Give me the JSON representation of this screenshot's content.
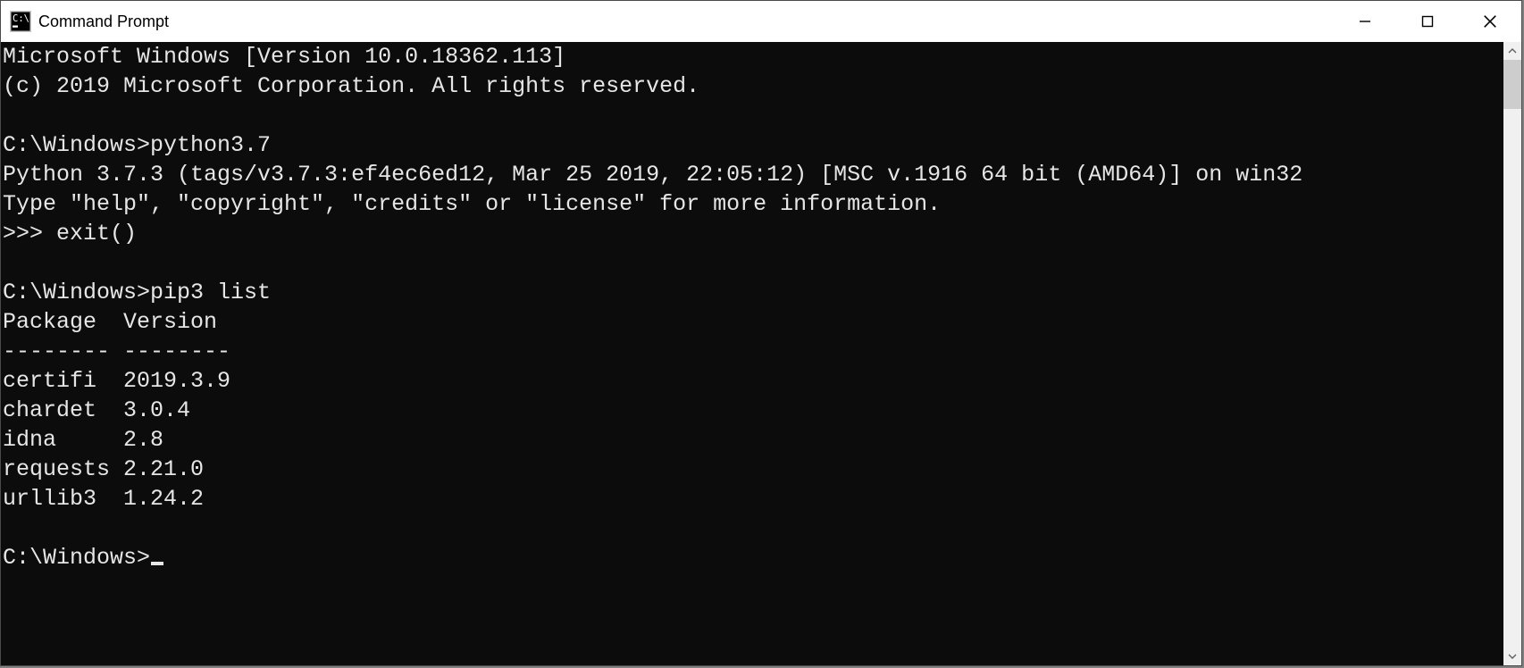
{
  "window": {
    "title": "Command Prompt"
  },
  "terminal": {
    "lines": [
      "Microsoft Windows [Version 10.0.18362.113]",
      "(c) 2019 Microsoft Corporation. All rights reserved.",
      "",
      "C:\\Windows>python3.7",
      "Python 3.7.3 (tags/v3.7.3:ef4ec6ed12, Mar 25 2019, 22:05:12) [MSC v.1916 64 bit (AMD64)] on win32",
      "Type \"help\", \"copyright\", \"credits\" or \"license\" for more information.",
      ">>> exit()",
      "",
      "C:\\Windows>pip3 list",
      "Package  Version",
      "-------- --------",
      "certifi  2019.3.9",
      "chardet  3.0.4",
      "idna     2.8",
      "requests 2.21.0",
      "urllib3  1.24.2",
      "",
      "C:\\Windows>"
    ]
  }
}
